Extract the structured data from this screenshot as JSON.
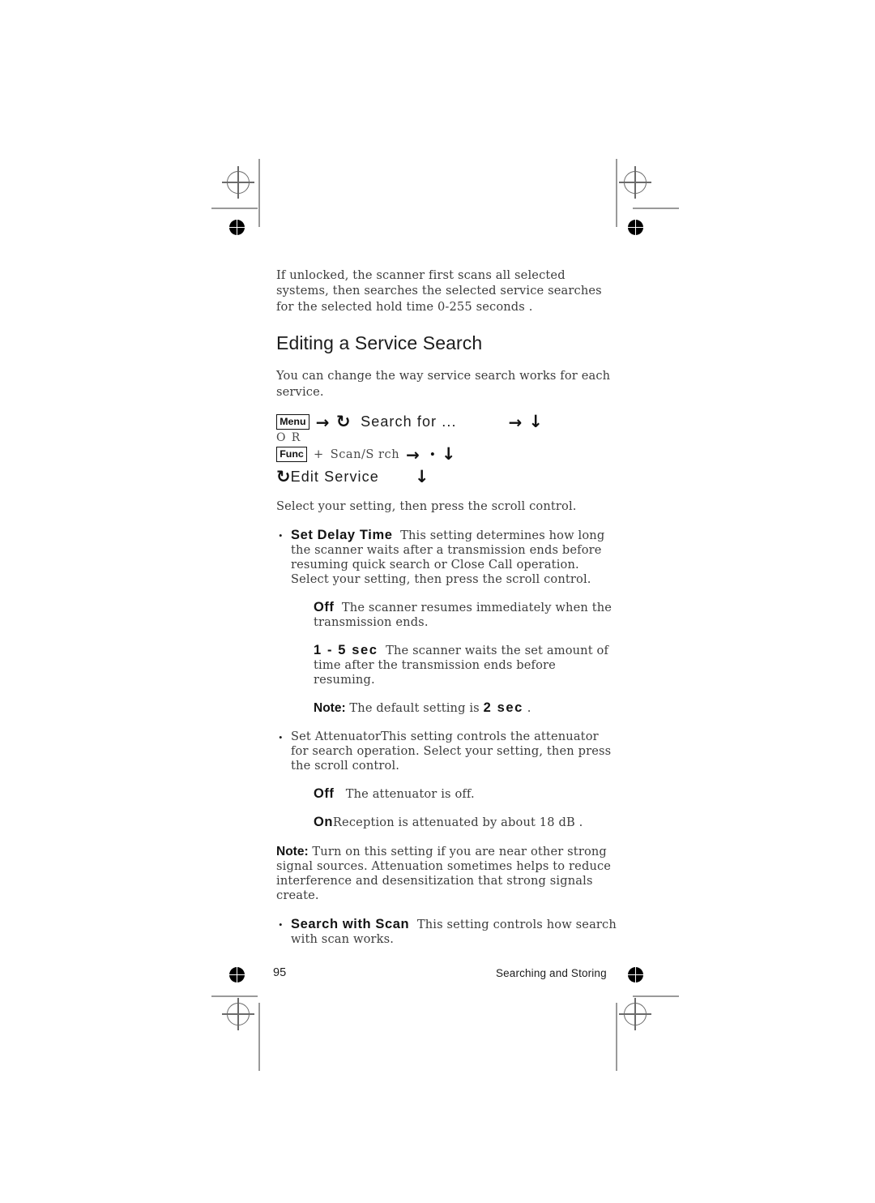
{
  "page": {
    "number": "95",
    "running_head": "Searching and Storing"
  },
  "intro_paragraph": "If unlocked, the scanner first scans all selected systems, then searches the selected service searches for the selected hold time 0-255 seconds .",
  "heading": "Editing a Service Search",
  "lead_paragraph": "You can change the way service search works for each service.",
  "key_sequence": {
    "line1": {
      "keycap": "Menu",
      "arrow_right": "→",
      "scroll_icon": "↺",
      "menu_item": "Search for ...",
      "arrow_right_2": "→",
      "arrow_down": "↓"
    },
    "or_label": "O R",
    "line3": {
      "keycap": "Func",
      "plus": "+",
      "key_label": "Scan/S rch",
      "arrow_right": "→",
      "dot": "•",
      "arrow_down": "↓"
    },
    "line4": {
      "scroll_icon": "↺",
      "menu_item": "Edit Service",
      "arrow_down": "↓"
    }
  },
  "select_instruction": "Select your setting, then press the scroll control.",
  "bullets": [
    {
      "marker": "•",
      "title": "Set Delay Time",
      "title_style": "bold",
      "body": "This setting determines how long the scanner waits after a transmission ends before resuming quick search or Close Call operation. Select your setting, then press the scroll control.",
      "options": [
        {
          "name": "Off",
          "name_style": "bold",
          "text": "The scanner resumes immediately when the transmission ends."
        },
        {
          "name": "1 - 5 sec",
          "name_style": "bold-wide",
          "text": "The scanner waits the set amount of time after the transmission ends before resuming."
        }
      ],
      "note": {
        "label": "Note:",
        "text_before": "The default setting is",
        "value": "2 sec",
        "text_after": "."
      }
    },
    {
      "marker": "•",
      "title": "Set Attenuator",
      "title_style": "thin",
      "body": "This setting controls the attenuator for search operation. Select your setting, then press the scroll control.",
      "options": [
        {
          "name": "Off",
          "name_style": "bold",
          "text": "The attenuator is off."
        },
        {
          "name": "On",
          "name_style": "bold",
          "text": "Reception is attenuated by about 18 dB ."
        }
      ]
    },
    {
      "marker": "•",
      "title": "Search with Scan",
      "title_style": "bold",
      "body": "This setting controls how search with scan works."
    }
  ],
  "attenuator_note": {
    "label": "Note:",
    "text": "Turn on this setting if you are near other strong signal sources. Attenuation sometimes helps to reduce interference and desensitization that strong signals create."
  }
}
